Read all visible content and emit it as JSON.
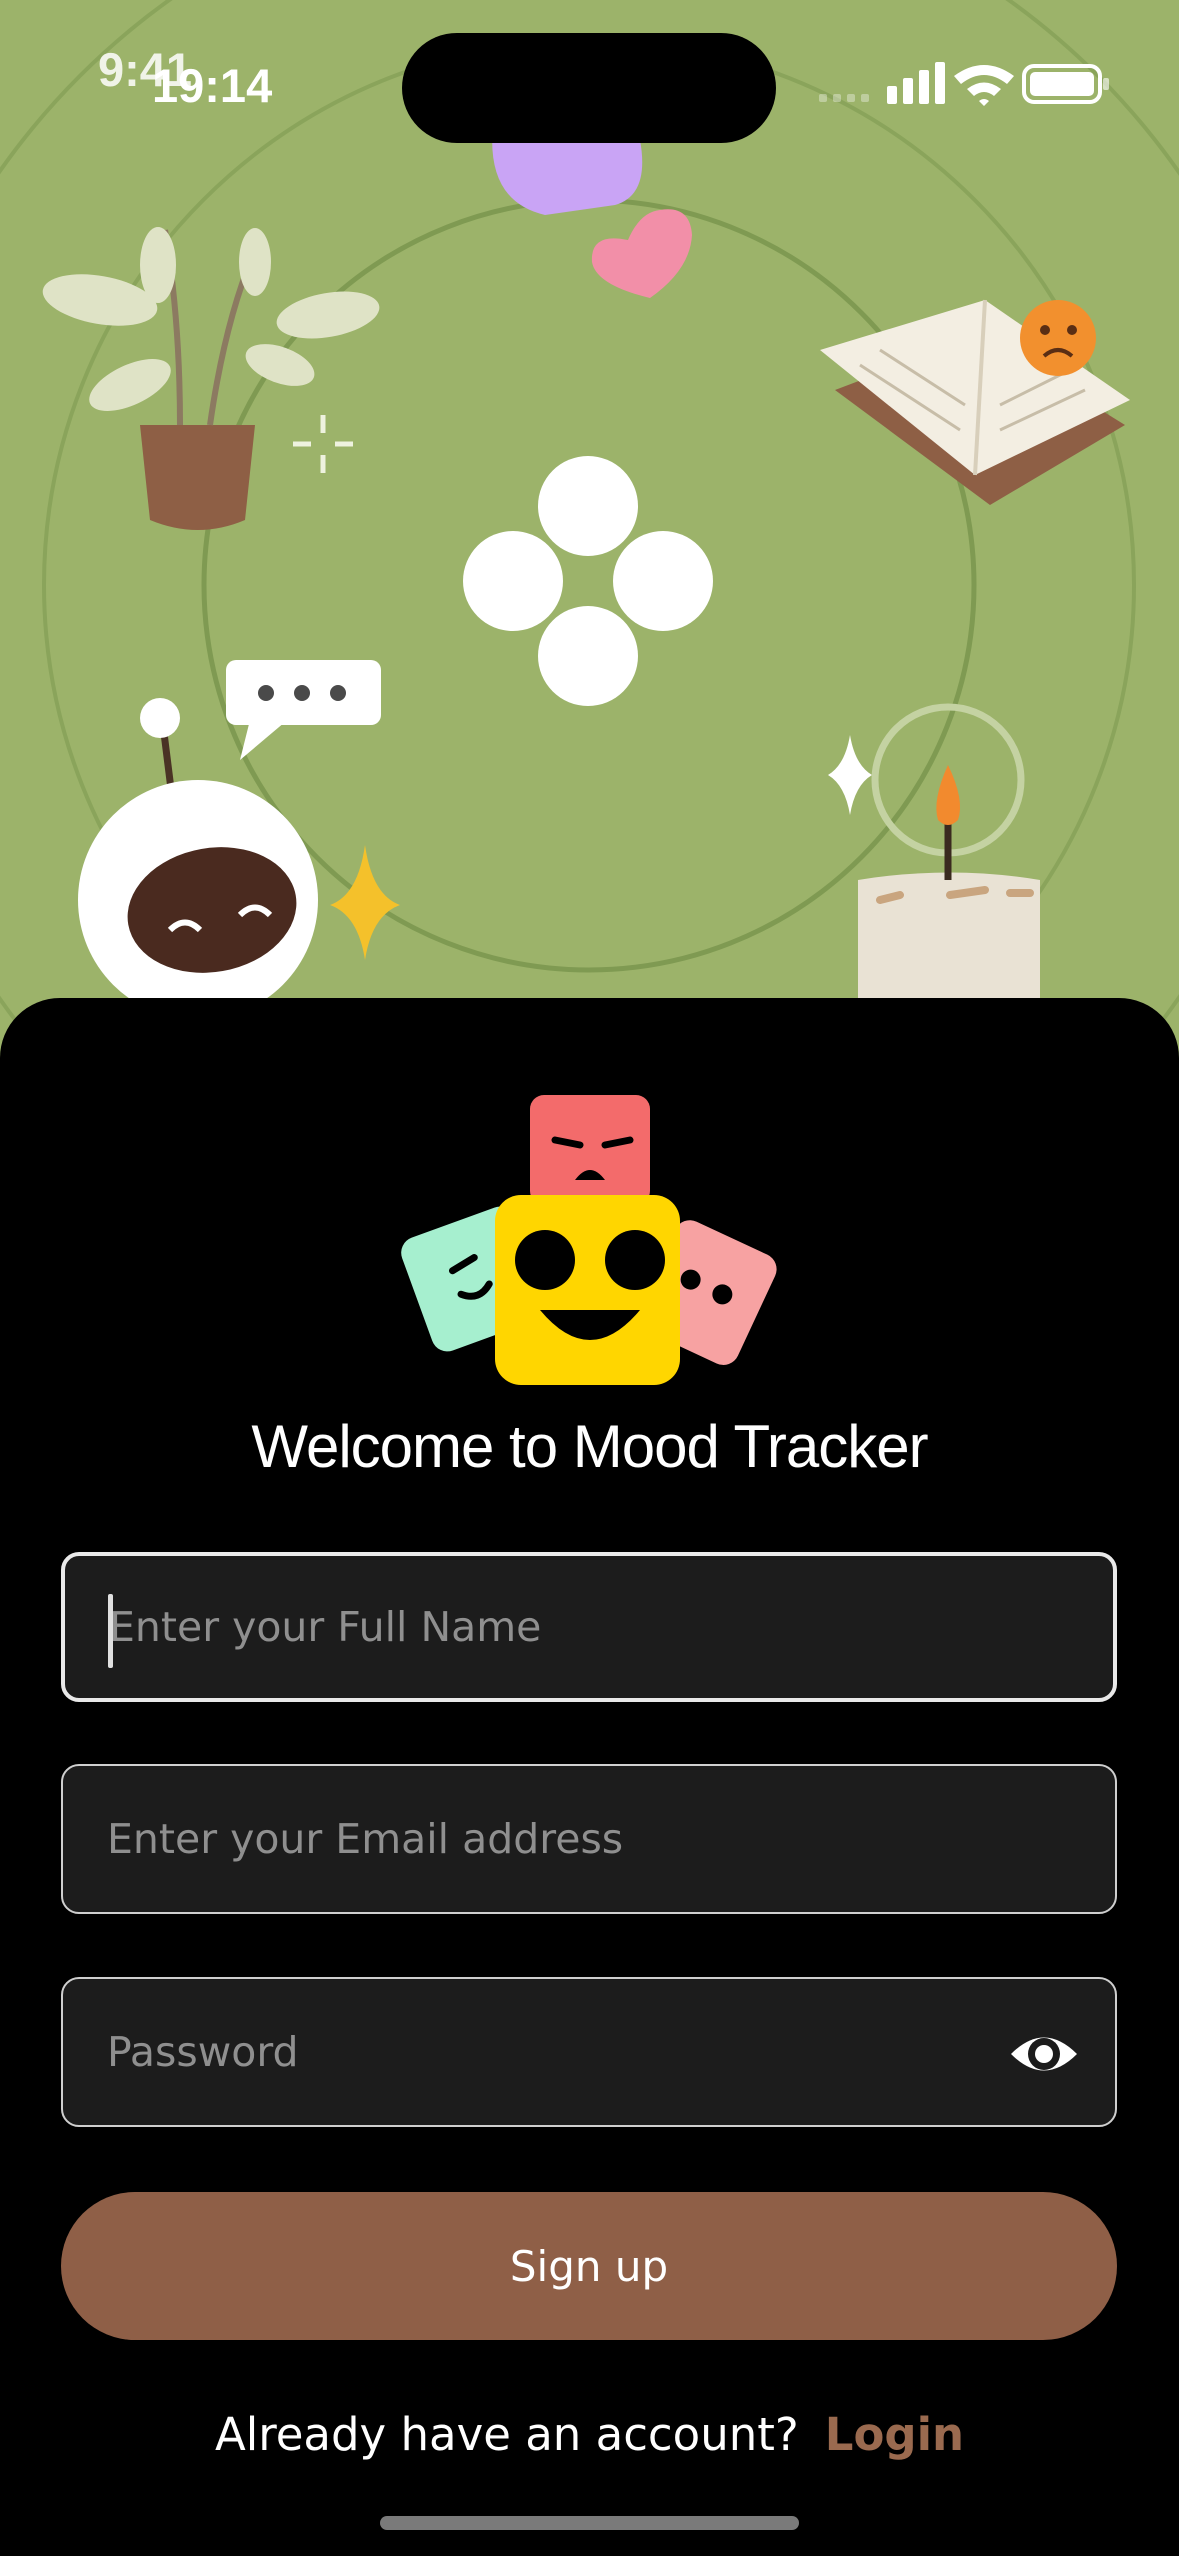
{
  "status_bar": {
    "time_ghost": "9:41",
    "time": "19:14"
  },
  "colors": {
    "hero_background": "#9cb36a",
    "sheet_background": "#000000",
    "field_background": "#1c1c1c",
    "button_background": "#8f5f47",
    "login_link": "#9a6a4f"
  },
  "welcome_title": "Welcome to Mood Tracker",
  "form": {
    "full_name": {
      "value": "",
      "placeholder": "Enter your Full Name"
    },
    "email": {
      "value": "",
      "placeholder": "Enter your Email address"
    },
    "password": {
      "value": "",
      "placeholder": "Password",
      "toggle_icon": "eye-icon"
    }
  },
  "signup_label": "Sign up",
  "footer": {
    "prompt": "Already have an account?",
    "login_label": "Login"
  },
  "icons": [
    "plant-icon",
    "heart-icon",
    "open-book-icon",
    "sad-face-icon",
    "robot-icon",
    "speech-bubble-icon",
    "candle-icon",
    "sparkle-icon",
    "flower-logo-icon",
    "mood-faces-logo",
    "eye-icon"
  ]
}
